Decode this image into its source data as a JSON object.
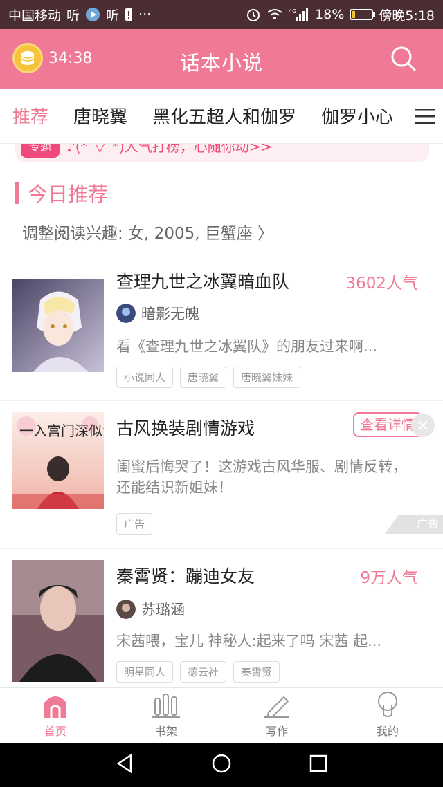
{
  "status_bar": {
    "carrier": "中国移动",
    "carrier_suffix": "听",
    "app_icons_text": "听",
    "more": "···",
    "battery_pct": "18%",
    "battery_level": 0.18,
    "time": "傍晚5:18",
    "network": "4G"
  },
  "header": {
    "timer": "34:38",
    "title": "话本小说"
  },
  "tabs": [
    "推荐",
    "唐晓翼",
    "黑化五超人和伽罗",
    "伽罗小心"
  ],
  "banner": {
    "tag": "专题",
    "text": "♪(*´▽`*)人气打榜，心随你动>>"
  },
  "section": {
    "title": "今日推荐",
    "prefs": "调整阅读兴趣: 女, 2005, 巨蟹座 〉"
  },
  "items": [
    {
      "title": "查理九世之冰翼暗血队",
      "popularity": "3602人气",
      "author": "暗影无魄",
      "desc": "看《查理九世之冰翼队》的朋友过来啊...",
      "tags": [
        "小说同人",
        "唐晓翼",
        "唐晓翼妹妹"
      ]
    },
    {
      "title": "古风换装剧情游戏",
      "button": "查看详情",
      "desc": "闺蜜后悔哭了！这游戏古风华服、剧情反转，还能结识新姐妹！",
      "tags": [
        "广告"
      ],
      "ad_mark": "广告",
      "cover_text": "一入宫门深似海"
    },
    {
      "title": "秦霄贤：蹦迪女友",
      "popularity": "9万人气",
      "author": "苏璐涵",
      "desc": "宋茜喂，宝儿 神秘人:起来了吗 宋茜 起...",
      "tags": [
        "明星同人",
        "德云社",
        "秦霄贤"
      ]
    }
  ],
  "bottom_nav": [
    {
      "label": "首页"
    },
    {
      "label": "书架"
    },
    {
      "label": "写作"
    },
    {
      "label": "我的"
    }
  ],
  "colors": {
    "accent": "#f07a95",
    "status_bar": "#4a2e34"
  }
}
